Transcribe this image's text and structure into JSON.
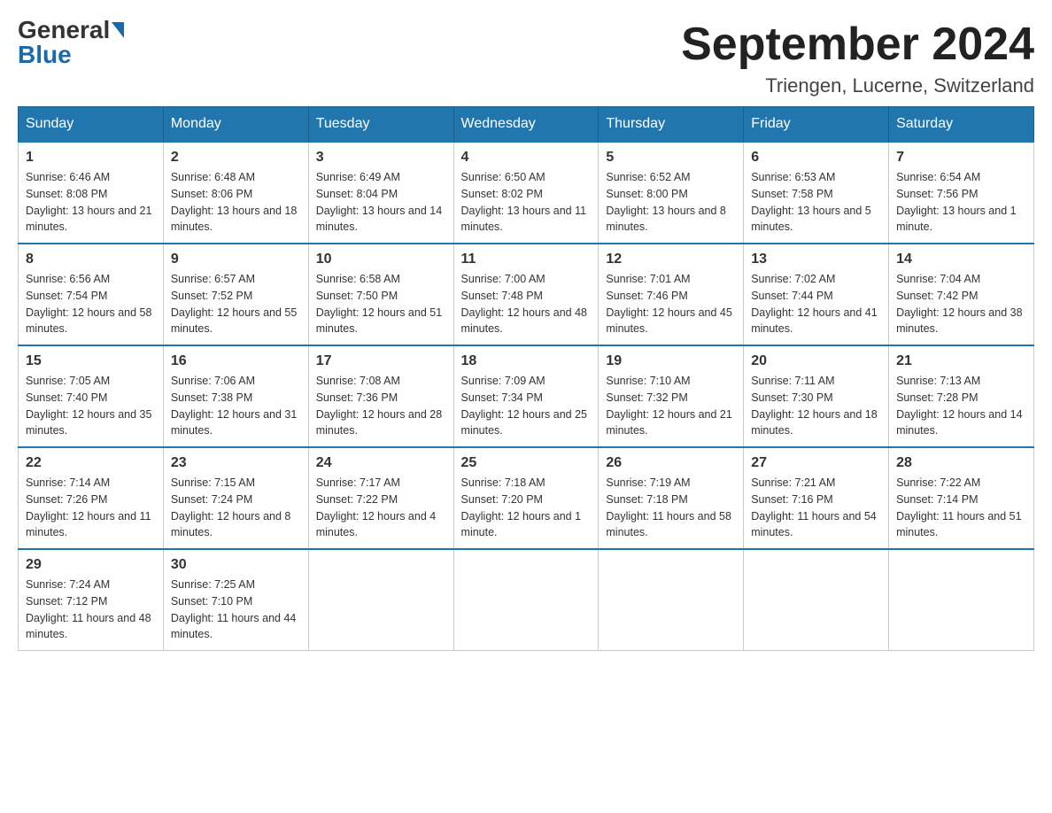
{
  "header": {
    "logo_general": "General",
    "logo_blue": "Blue",
    "month_title": "September 2024",
    "location": "Triengen, Lucerne, Switzerland"
  },
  "weekdays": [
    "Sunday",
    "Monday",
    "Tuesday",
    "Wednesday",
    "Thursday",
    "Friday",
    "Saturday"
  ],
  "weeks": [
    [
      {
        "day": "1",
        "sunrise": "6:46 AM",
        "sunset": "8:08 PM",
        "daylight": "13 hours and 21 minutes."
      },
      {
        "day": "2",
        "sunrise": "6:48 AM",
        "sunset": "8:06 PM",
        "daylight": "13 hours and 18 minutes."
      },
      {
        "day": "3",
        "sunrise": "6:49 AM",
        "sunset": "8:04 PM",
        "daylight": "13 hours and 14 minutes."
      },
      {
        "day": "4",
        "sunrise": "6:50 AM",
        "sunset": "8:02 PM",
        "daylight": "13 hours and 11 minutes."
      },
      {
        "day": "5",
        "sunrise": "6:52 AM",
        "sunset": "8:00 PM",
        "daylight": "13 hours and 8 minutes."
      },
      {
        "day": "6",
        "sunrise": "6:53 AM",
        "sunset": "7:58 PM",
        "daylight": "13 hours and 5 minutes."
      },
      {
        "day": "7",
        "sunrise": "6:54 AM",
        "sunset": "7:56 PM",
        "daylight": "13 hours and 1 minute."
      }
    ],
    [
      {
        "day": "8",
        "sunrise": "6:56 AM",
        "sunset": "7:54 PM",
        "daylight": "12 hours and 58 minutes."
      },
      {
        "day": "9",
        "sunrise": "6:57 AM",
        "sunset": "7:52 PM",
        "daylight": "12 hours and 55 minutes."
      },
      {
        "day": "10",
        "sunrise": "6:58 AM",
        "sunset": "7:50 PM",
        "daylight": "12 hours and 51 minutes."
      },
      {
        "day": "11",
        "sunrise": "7:00 AM",
        "sunset": "7:48 PM",
        "daylight": "12 hours and 48 minutes."
      },
      {
        "day": "12",
        "sunrise": "7:01 AM",
        "sunset": "7:46 PM",
        "daylight": "12 hours and 45 minutes."
      },
      {
        "day": "13",
        "sunrise": "7:02 AM",
        "sunset": "7:44 PM",
        "daylight": "12 hours and 41 minutes."
      },
      {
        "day": "14",
        "sunrise": "7:04 AM",
        "sunset": "7:42 PM",
        "daylight": "12 hours and 38 minutes."
      }
    ],
    [
      {
        "day": "15",
        "sunrise": "7:05 AM",
        "sunset": "7:40 PM",
        "daylight": "12 hours and 35 minutes."
      },
      {
        "day": "16",
        "sunrise": "7:06 AM",
        "sunset": "7:38 PM",
        "daylight": "12 hours and 31 minutes."
      },
      {
        "day": "17",
        "sunrise": "7:08 AM",
        "sunset": "7:36 PM",
        "daylight": "12 hours and 28 minutes."
      },
      {
        "day": "18",
        "sunrise": "7:09 AM",
        "sunset": "7:34 PM",
        "daylight": "12 hours and 25 minutes."
      },
      {
        "day": "19",
        "sunrise": "7:10 AM",
        "sunset": "7:32 PM",
        "daylight": "12 hours and 21 minutes."
      },
      {
        "day": "20",
        "sunrise": "7:11 AM",
        "sunset": "7:30 PM",
        "daylight": "12 hours and 18 minutes."
      },
      {
        "day": "21",
        "sunrise": "7:13 AM",
        "sunset": "7:28 PM",
        "daylight": "12 hours and 14 minutes."
      }
    ],
    [
      {
        "day": "22",
        "sunrise": "7:14 AM",
        "sunset": "7:26 PM",
        "daylight": "12 hours and 11 minutes."
      },
      {
        "day": "23",
        "sunrise": "7:15 AM",
        "sunset": "7:24 PM",
        "daylight": "12 hours and 8 minutes."
      },
      {
        "day": "24",
        "sunrise": "7:17 AM",
        "sunset": "7:22 PM",
        "daylight": "12 hours and 4 minutes."
      },
      {
        "day": "25",
        "sunrise": "7:18 AM",
        "sunset": "7:20 PM",
        "daylight": "12 hours and 1 minute."
      },
      {
        "day": "26",
        "sunrise": "7:19 AM",
        "sunset": "7:18 PM",
        "daylight": "11 hours and 58 minutes."
      },
      {
        "day": "27",
        "sunrise": "7:21 AM",
        "sunset": "7:16 PM",
        "daylight": "11 hours and 54 minutes."
      },
      {
        "day": "28",
        "sunrise": "7:22 AM",
        "sunset": "7:14 PM",
        "daylight": "11 hours and 51 minutes."
      }
    ],
    [
      {
        "day": "29",
        "sunrise": "7:24 AM",
        "sunset": "7:12 PM",
        "daylight": "11 hours and 48 minutes."
      },
      {
        "day": "30",
        "sunrise": "7:25 AM",
        "sunset": "7:10 PM",
        "daylight": "11 hours and 44 minutes."
      },
      null,
      null,
      null,
      null,
      null
    ]
  ]
}
